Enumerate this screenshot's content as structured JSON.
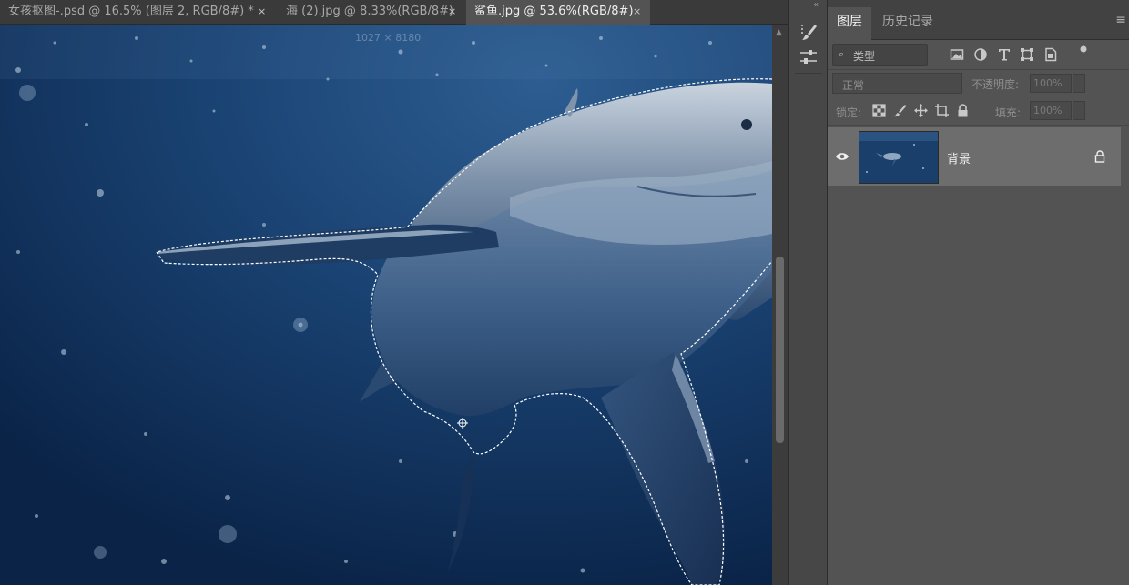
{
  "document_tabs": [
    {
      "label": "女孩抠图-.psd @ 16.5% (图层 2, RGB/8#) *",
      "active": false
    },
    {
      "label": "海 (2).jpg @ 8.33%(RGB/8#)",
      "active": false
    },
    {
      "label": "鲨鱼.jpg @ 53.6%(RGB/8#)",
      "active": true
    }
  ],
  "tab_close_glyph": "×",
  "canvas": {
    "ghost_coordinates": "1027 × 8180",
    "image_subject": "great white shark underwater",
    "selection_style": "marching ants (dashed white outline)"
  },
  "toolstrip": {
    "collapse_glyph": "«",
    "tools": [
      {
        "name": "brush-presets-icon"
      },
      {
        "name": "adjust-sliders-icon"
      }
    ]
  },
  "panel": {
    "tabs": [
      {
        "label": "图层",
        "active": true
      },
      {
        "label": "历史记录",
        "active": false
      }
    ],
    "menu_glyph": "≡",
    "filter": {
      "search_glyph": "⌕",
      "kind_label": "类型",
      "filter_icons": [
        "image-filter-icon",
        "adjustment-filter-icon",
        "type-filter-icon",
        "shape-filter-icon",
        "smart-object-filter-icon",
        "filter-toggle-dot-icon"
      ]
    },
    "blend_mode": "正常",
    "opacity_label": "不透明度:",
    "opacity_value": "100%",
    "lock_label": "锁定:",
    "lock_icons": [
      "lock-transparent-icon",
      "lock-pixels-icon",
      "lock-position-icon",
      "lock-artboard-icon",
      "lock-all-icon"
    ],
    "fill_label": "填充:",
    "fill_value": "100%",
    "layers": [
      {
        "name": "背景",
        "visible": true,
        "locked": true,
        "selected": true
      }
    ]
  },
  "colors": {
    "ui_dark": "#3a3a3a",
    "ui_mid": "#535353",
    "selected_layer": "#6d6d6d",
    "ocean_deep": "#0d2a50",
    "ocean_light": "#24507f"
  }
}
